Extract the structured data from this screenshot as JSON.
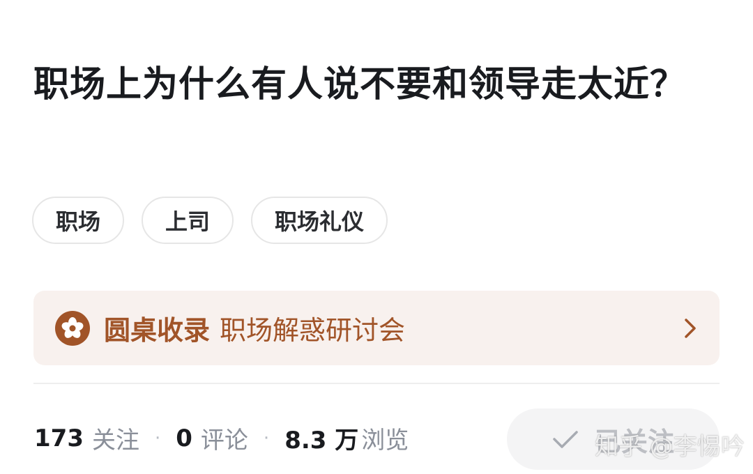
{
  "question": {
    "title": "职场上为什么有人说不要和领导走太近？"
  },
  "tags": [
    {
      "label": "职场"
    },
    {
      "label": "上司"
    },
    {
      "label": "职场礼仪"
    }
  ],
  "roundtable": {
    "label": "圆桌收录",
    "name": "职场解惑研讨会",
    "accent_color": "#a15428",
    "background_color": "#f8f1ee",
    "icon": "roundtable-flower-icon"
  },
  "stats": {
    "followers_count": "173",
    "followers_label": "关注",
    "comments_count": "0",
    "comments_label": "评论",
    "views_count": "8.3 万",
    "views_label": "浏览",
    "separator": "·"
  },
  "follow_button": {
    "label": "已关注",
    "icon": "check-icon"
  },
  "watermark": {
    "text": "知乎 @李惕吟"
  }
}
